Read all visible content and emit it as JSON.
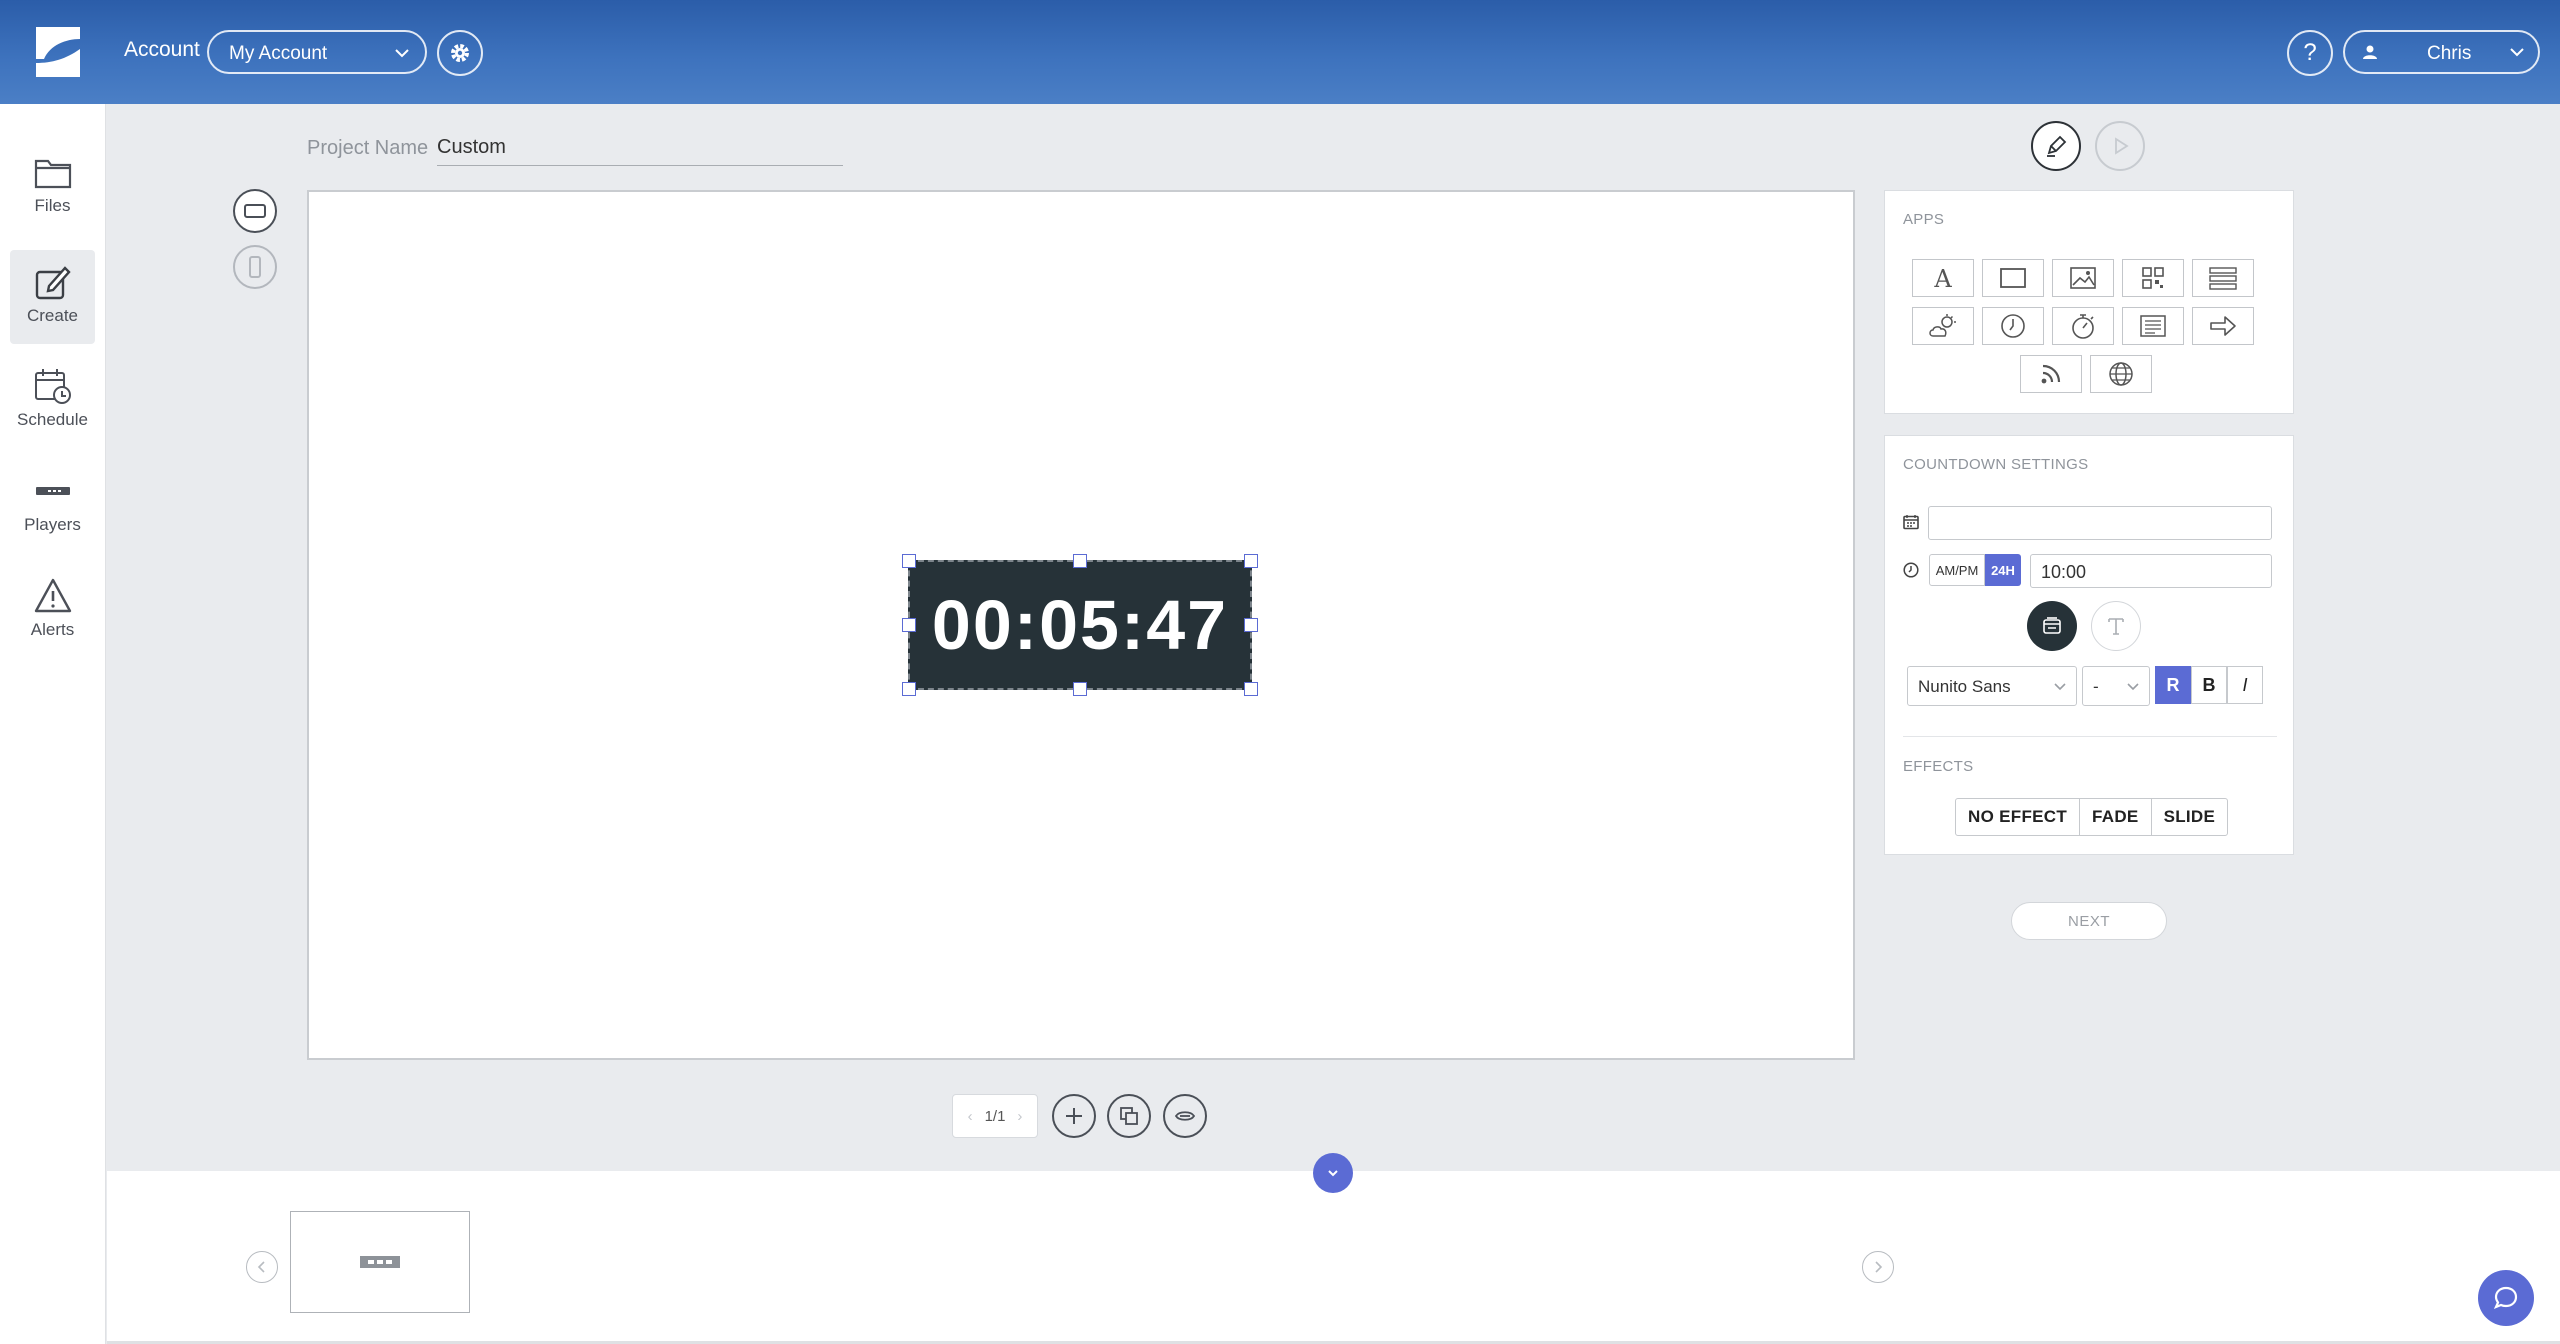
{
  "header": {
    "account_label": "Account",
    "account_select": "My Account",
    "help_label": "?",
    "user_name": "Chris"
  },
  "sidebar": {
    "items": [
      {
        "label": "Files",
        "icon": "folder-icon"
      },
      {
        "label": "Create",
        "icon": "edit-icon",
        "active": true
      },
      {
        "label": "Schedule",
        "icon": "calendar-clock-icon"
      },
      {
        "label": "Players",
        "icon": "player-device-icon"
      },
      {
        "label": "Alerts",
        "icon": "warning-icon"
      }
    ]
  },
  "project": {
    "name_label": "Project Name",
    "name_value": "Custom"
  },
  "canvas": {
    "countdown_value": "00:05:47"
  },
  "pager": {
    "page_indicator": "1/1",
    "prev": "‹",
    "next": "›"
  },
  "apps_panel": {
    "title": "APPS",
    "apps": [
      "text-icon",
      "rectangle-icon",
      "image-icon",
      "qr-code-icon",
      "list-layout-icon",
      "weather-icon",
      "clock-icon",
      "countdown-icon",
      "ticker-icon",
      "arrow-icon",
      "rss-icon",
      "web-icon"
    ]
  },
  "countdown_settings": {
    "title": "COUNTDOWN SETTINGS",
    "date_value": "",
    "ampm_label": "AM/PM",
    "h24_label": "24H",
    "time_value": "10:00",
    "font_family": "Nunito Sans",
    "font_size": "-",
    "format_regular": "R",
    "format_bold": "B",
    "format_italic": "I",
    "effects_title": "EFFECTS",
    "effects": [
      "NO EFFECT",
      "FADE",
      "SLIDE"
    ]
  },
  "next_label": "NEXT",
  "colors": {
    "header_blue": "#3d72bd",
    "accent": "#5b6bd4",
    "countdown_bg": "#263238"
  }
}
